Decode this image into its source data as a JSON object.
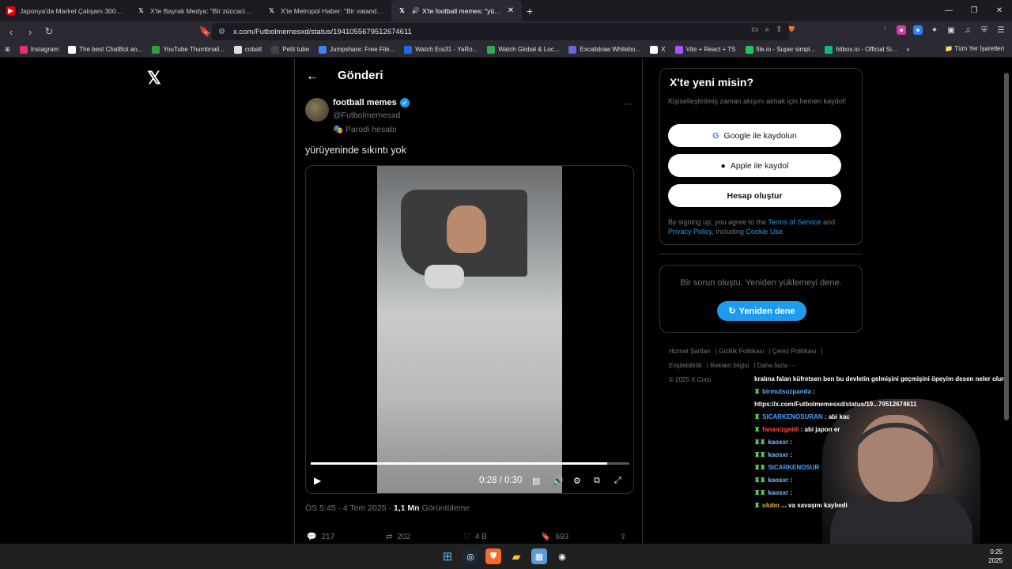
{
  "browser": {
    "tabs": [
      {
        "label": "Japonya'da Market Çalışanı 3000 Dol",
        "icon": "youtube-icon",
        "active": false
      },
      {
        "label": "X'te Bayrak Medya: \"Bir züccaciyeci, A",
        "icon": "x-icon",
        "active": false
      },
      {
        "label": "X'te Metropol Haber: \"Bir vatandaş: E",
        "icon": "x-icon",
        "active": false
      },
      {
        "label": "X'te football memes: \"yürüye",
        "icon": "x-icon",
        "active": true
      }
    ],
    "url": "x.com/Futbolmemesxd/status/1941055679512674611",
    "bookmarks": [
      {
        "label": "Instagram",
        "color": "#e1306c"
      },
      {
        "label": "The best ChatBot an...",
        "color": "#ffffff"
      },
      {
        "label": "YouTube Thumbnail...",
        "color": "#2ea043"
      },
      {
        "label": "cobalt",
        "color": "#ffffff"
      },
      {
        "label": "Petit tube",
        "color": "#222222"
      },
      {
        "label": "Jumpshare: Free File...",
        "color": "#3b82f6"
      },
      {
        "label": "Watch Era31 - YaRo...",
        "color": "#1d6ae5"
      },
      {
        "label": "Watch Global & Loc...",
        "color": "#35a853"
      },
      {
        "label": "Excalidraw Whitebo...",
        "color": "#6965db"
      },
      {
        "label": "X",
        "color": "#ffffff"
      },
      {
        "label": "Vite + React + TS",
        "color": "#a855f7"
      },
      {
        "label": "file.io - Super simpl...",
        "color": "#22c55e"
      },
      {
        "label": "hitbox.io - Official Si...",
        "color": "#10b981"
      }
    ],
    "all_bookmarks": "Tüm Yer İşaretleri"
  },
  "post": {
    "header_title": "Gönderi",
    "display_name": "football memes",
    "handle": "@Futbolmemesxd",
    "parody_label": "Parodi hesabı",
    "text": "yürüyeninde sıkıntı yok",
    "video": {
      "time": "0:28 / 0:30",
      "progress": 0.93
    },
    "meta_time": "ÖS 5:45 · 4 Tem 2025 · ",
    "views_count": "1,1 Mn",
    "views_label": " Görüntüleme",
    "replies": "217",
    "reposts": "202",
    "likes": "4 B",
    "bookmarks": "693"
  },
  "sidebar": {
    "signup_title": "X'te yeni misin?",
    "signup_desc": "Kişiselleştirilmiş zaman akışını almak için hemen kaydol!",
    "google_btn": "Google ile kaydolun",
    "apple_btn": "Apple ile kaydol",
    "create_btn": "Hesap oluştur",
    "legal_pre": "By signing up, you agree to the ",
    "terms": "Terms of Service",
    "and": " and ",
    "privacy": "Privacy Policy",
    "including": ", including ",
    "cookie": "Cookie Use.",
    "error_msg": "Bir sorun oluştu. Yeniden yüklemeyi dene.",
    "retry_btn": "Yeniden dene",
    "footer": [
      "Hizmet Şartları",
      "Gizlilik Politikası",
      "Çerez Politikası",
      "Erişilebilirlik",
      "Reklam bilgisi",
      "Daha fazla ···",
      "© 2025 X Corp."
    ]
  },
  "chat": {
    "lines": [
      {
        "user": "",
        "text": "kralına falan küfretsen ben bu devletin gelmişini geçmişini öpeyim desen neler olur"
      },
      {
        "user": "birmutsuzpanda",
        "text": " :"
      },
      {
        "user": "",
        "text": "https://x.com/Futbolmemesxd/status/19...79512674611"
      },
      {
        "user": "SICARKENOSURAN",
        "text": " : abi kac"
      },
      {
        "user": "fananizgeldi",
        "text": " : abi japon er"
      },
      {
        "user": "kaosxr",
        "text": " :"
      },
      {
        "user": "kaosxr",
        "text": " :"
      },
      {
        "user": "SICARKENOSUR",
        "text": ""
      },
      {
        "user": "kaosxr",
        "text": " :"
      },
      {
        "user": "kaosxr",
        "text": " :"
      },
      {
        "user": "ulubo",
        "text": " ... va savaşını kaybedi"
      }
    ]
  },
  "taskbar": {
    "time": "0:25",
    "date": "2025"
  }
}
